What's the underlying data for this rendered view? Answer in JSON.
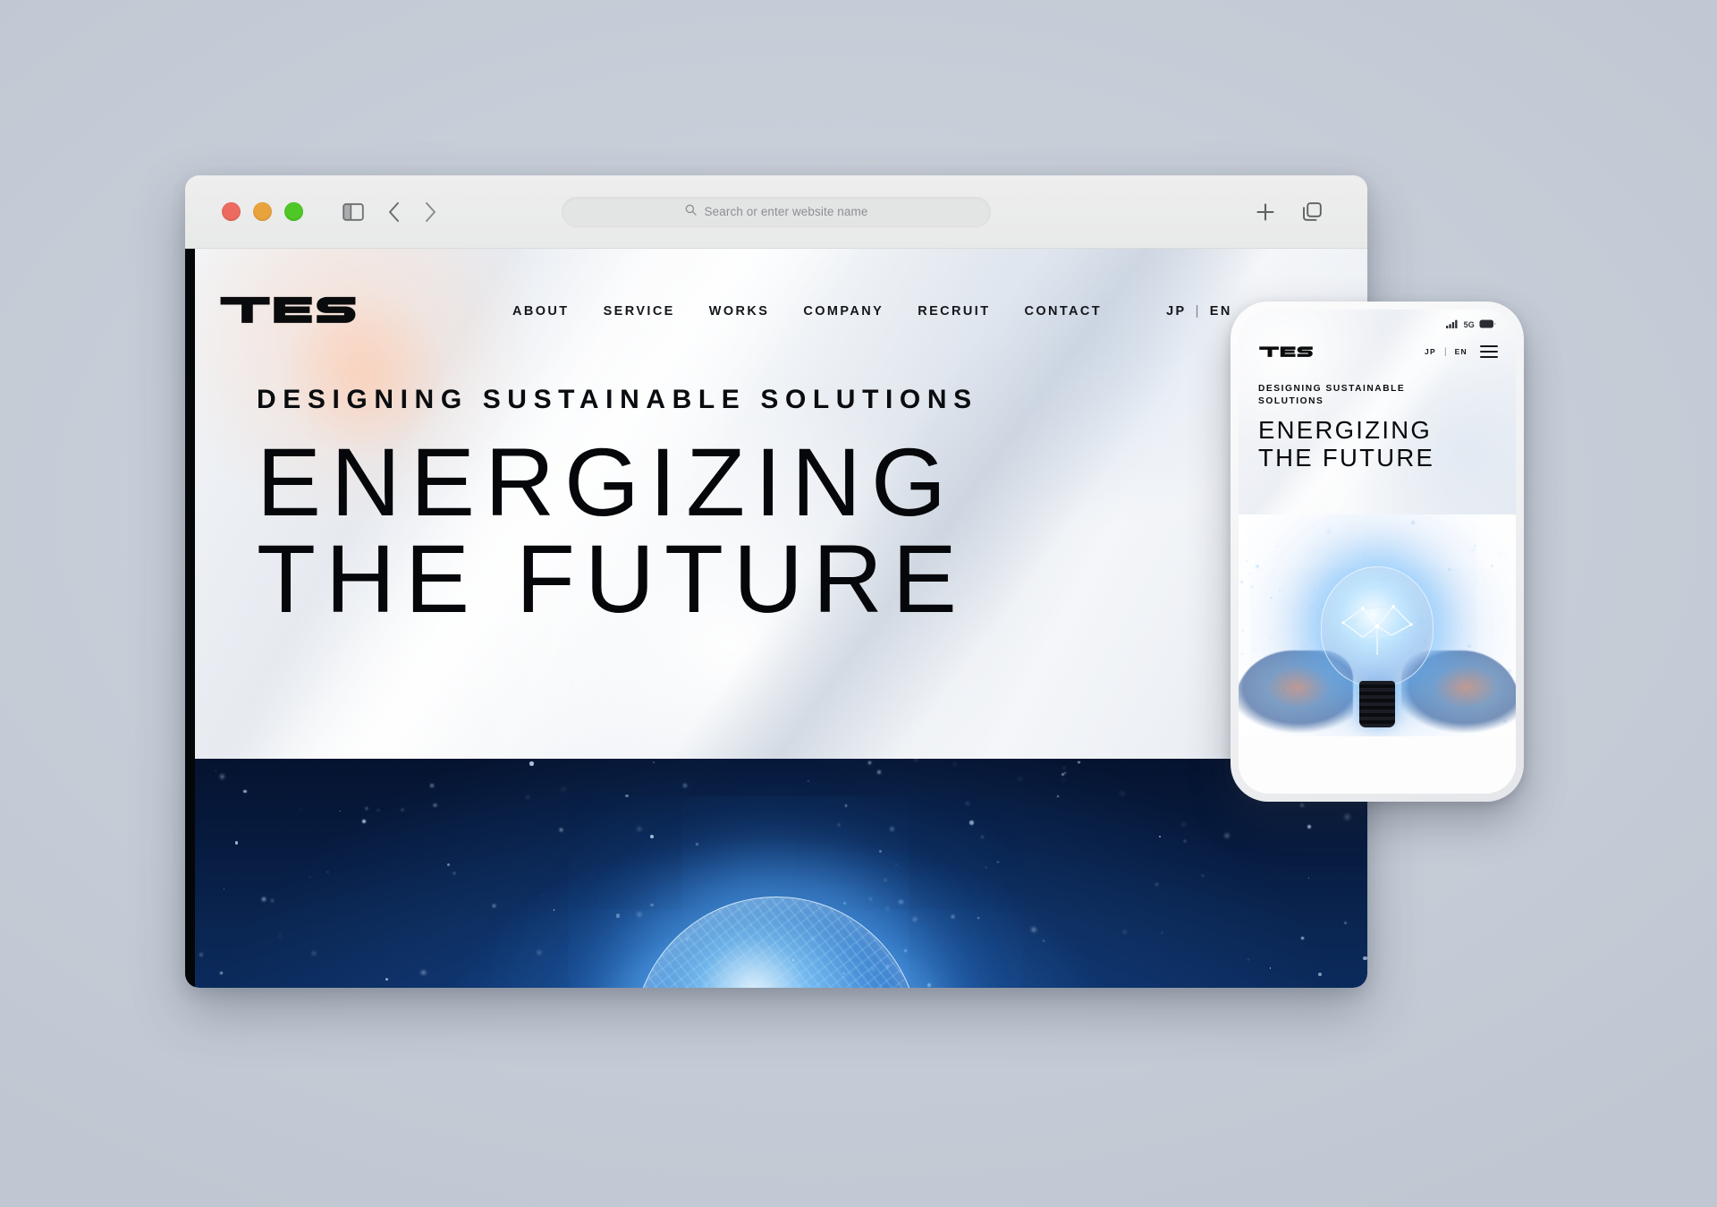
{
  "browser": {
    "traffic_lights": [
      "close-red",
      "minimize-yellow",
      "maximize-green"
    ],
    "sidebar_icon": "sidebar-toggle-icon",
    "back_icon": "chevron-left-icon",
    "forward_icon": "chevron-right-icon",
    "address_placeholder": "Search or enter website name",
    "search_icon": "search-icon",
    "new_tab_icon": "plus-icon",
    "tab_overview_icon": "tab-overview-icon"
  },
  "site": {
    "logo": "TES",
    "nav": [
      {
        "label": "ABOUT"
      },
      {
        "label": "SERVICE"
      },
      {
        "label": "WORKS"
      },
      {
        "label": "COMPANY"
      },
      {
        "label": "RECRUIT"
      },
      {
        "label": "CONTACT"
      }
    ],
    "lang": {
      "jp": "JP",
      "divider": "|",
      "en": "EN"
    },
    "hero": {
      "eyebrow": "DESIGNING SUSTAINABLE SOLUTIONS",
      "headline_line1": "ENERGIZING",
      "headline_line2": "THE FUTURE",
      "image_alt": "glowing-lightbulb-starfield"
    }
  },
  "phone": {
    "status": {
      "signal": "signal-bars-icon",
      "network": "5G",
      "battery": "battery-icon"
    },
    "logo": "TES",
    "lang": {
      "jp": "JP",
      "divider": "|",
      "en": "EN"
    },
    "menu_icon": "hamburger-menu-icon",
    "hero": {
      "eyebrow_line1": "DESIGNING SUSTAINABLE",
      "eyebrow_line2": "SOLUTIONS",
      "headline_line1": "ENERGIZING",
      "headline_line2": "THE FUTURE",
      "image_alt": "hands-holding-glowing-lightbulb"
    }
  },
  "colors": {
    "page_background": "#c8cfd9",
    "chrome": "#ececec",
    "text_dark": "#05070a",
    "hero_dark_blue": "#071c41",
    "accent_glow": "#5cb2ff"
  }
}
